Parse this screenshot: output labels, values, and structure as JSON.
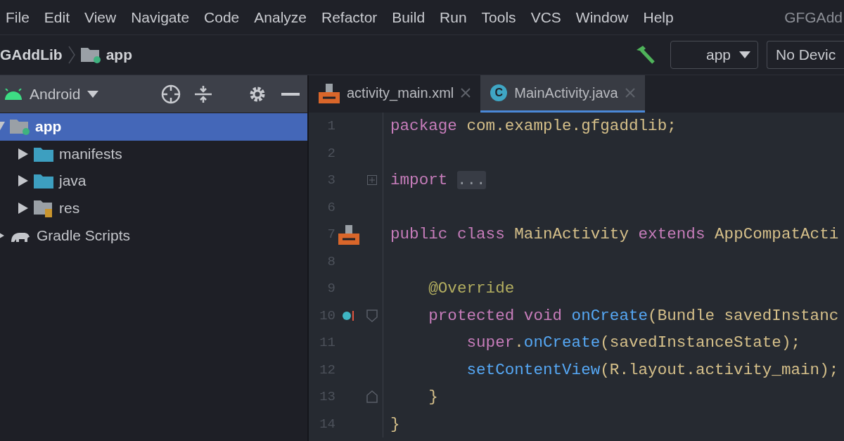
{
  "menu": [
    {
      "label": "File"
    },
    {
      "label": "Edit"
    },
    {
      "label": "View"
    },
    {
      "label": "Navigate"
    },
    {
      "label": "Code"
    },
    {
      "label": "Analyze"
    },
    {
      "label": "Refactor"
    },
    {
      "label": "Build"
    },
    {
      "label": "Run"
    },
    {
      "label": "Tools"
    },
    {
      "label": "VCS"
    },
    {
      "label": "Window"
    },
    {
      "label": "Help"
    }
  ],
  "window_title": "GFGAdd",
  "breadcrumb": {
    "project": "GAddLib",
    "module": "app"
  },
  "toolbar": {
    "config": "app",
    "device": "No Devic"
  },
  "project_panel": {
    "view": "Android",
    "tree": [
      {
        "label": "app",
        "kind": "module",
        "selected": true,
        "expanded": true,
        "children": [
          {
            "label": "manifests",
            "kind": "folder",
            "selected": false,
            "expanded": false
          },
          {
            "label": "java",
            "kind": "folder",
            "selected": false,
            "expanded": false
          },
          {
            "label": "res",
            "kind": "res",
            "selected": false,
            "expanded": false
          }
        ]
      },
      {
        "label": "Gradle Scripts",
        "kind": "gradle",
        "selected": false,
        "expanded": false
      }
    ]
  },
  "tabs": [
    {
      "label": "activity_main.xml",
      "kind": "xml",
      "selected": false
    },
    {
      "label": "MainActivity.java",
      "kind": "class",
      "icon_letter": "C",
      "selected": true
    }
  ],
  "editor": {
    "lines": [
      {
        "number": "1",
        "tokens": [
          {
            "text": "package",
            "kind": "keyword"
          },
          {
            "text": " com.example.gfgaddlib;",
            "kind": "plain"
          }
        ]
      },
      {
        "number": "2"
      },
      {
        "number": "3",
        "fold_marker": {
          "kind": "expand"
        },
        "tokens": [
          {
            "text": "import",
            "kind": "keyword"
          },
          {
            "text": "...",
            "kind": "folded"
          }
        ]
      },
      {
        "number": "6"
      },
      {
        "number": "7",
        "gutter_icon": {
          "kind": "layout"
        },
        "tokens": [
          {
            "text": "public class",
            "kind": "keyword"
          },
          {
            "text": " MainActivity ",
            "kind": "plain"
          },
          {
            "text": "extends",
            "kind": "keyword"
          },
          {
            "text": " AppCompatActi",
            "kind": "plain"
          }
        ]
      },
      {
        "number": "8"
      },
      {
        "number": "9",
        "tokens": [
          {
            "text": "    @Override",
            "kind": "annotation"
          }
        ]
      },
      {
        "number": "10",
        "gutter_icon": {
          "kind": "override"
        },
        "fold_marker": {
          "kind": "start"
        },
        "tokens": [
          {
            "text": "    protected void",
            "kind": "keyword"
          },
          {
            "text": " onCreate",
            "kind": "method"
          },
          {
            "text": "(Bundle savedInstanc",
            "kind": "plain"
          }
        ]
      },
      {
        "number": "11",
        "tokens": [
          {
            "text": "        super",
            "kind": "keyword"
          },
          {
            "text": ".",
            "kind": "plain"
          },
          {
            "text": "onCreate",
            "kind": "method"
          },
          {
            "text": "(savedInstanceState);",
            "kind": "plain"
          }
        ]
      },
      {
        "number": "12",
        "tokens": [
          {
            "text": "        setContentView",
            "kind": "method"
          },
          {
            "text": "(R.layout.activity_main);",
            "kind": "plain"
          }
        ]
      },
      {
        "number": "13",
        "fold_marker": {
          "kind": "end"
        },
        "tokens": [
          {
            "text": "    }",
            "kind": "plain"
          }
        ]
      },
      {
        "number": "14",
        "tokens": [
          {
            "text": "}",
            "kind": "plain"
          }
        ]
      }
    ]
  }
}
